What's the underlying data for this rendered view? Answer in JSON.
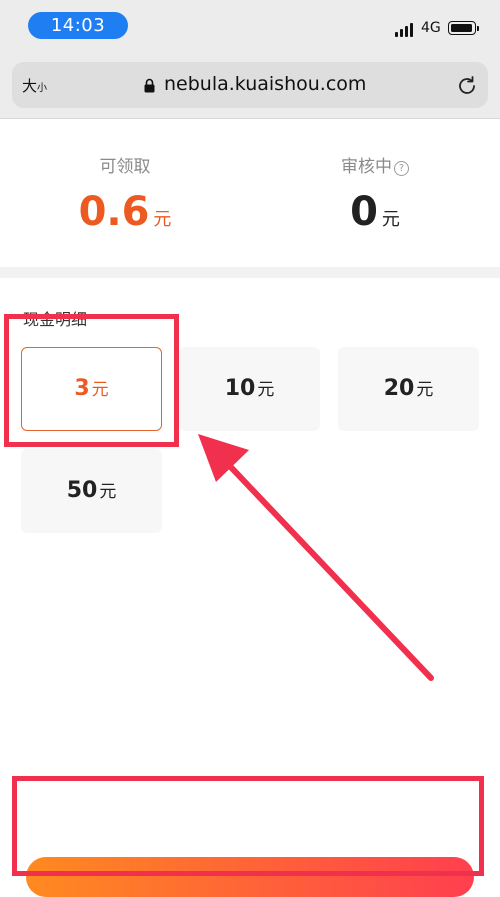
{
  "status_bar": {
    "time": "14:03",
    "network": "4G"
  },
  "browser": {
    "text_size_big": "大",
    "text_size_small": "小",
    "url": "nebula.kuaishou.com"
  },
  "summary": {
    "available": {
      "label": "可领取",
      "value": "0.6",
      "unit": "元"
    },
    "reviewing": {
      "label": "审核中",
      "value": "0",
      "unit": "元",
      "help": "?"
    }
  },
  "cash_detail": {
    "title": "现金明细",
    "options": [
      {
        "amount": "3",
        "unit": "元",
        "selected": true
      },
      {
        "amount": "10",
        "unit": "元",
        "selected": false
      },
      {
        "amount": "20",
        "unit": "元",
        "selected": false
      },
      {
        "amount": "50",
        "unit": "元",
        "selected": false
      }
    ]
  },
  "colors": {
    "accent": "#ec5a22",
    "annotation": "#f0304c",
    "time_pill": "#1f7ef2"
  }
}
